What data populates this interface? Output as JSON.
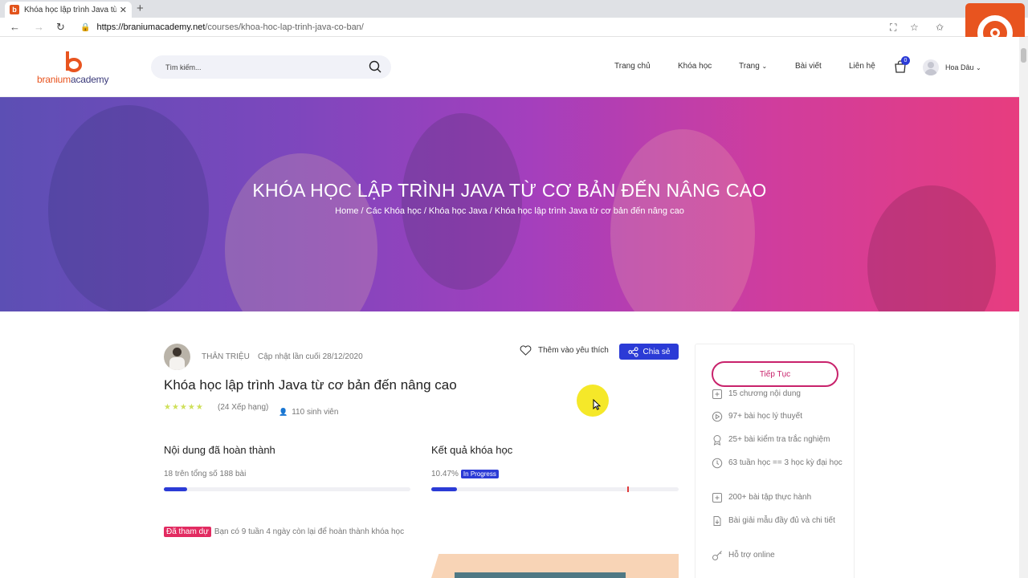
{
  "browser": {
    "tab_title": "Khóa học lập trình Java từ cơ bả",
    "tab_favicon": "b",
    "new_tab": "+",
    "url_host": "https://braniumacademy.net",
    "url_path": "/courses/khoa-hoc-lap-trinh-java-co-ban/"
  },
  "site": {
    "logo_part1": "branium",
    "logo_part2": "academy",
    "search_placeholder": "Tìm kiếm...",
    "nav": [
      "Trang chủ",
      "Khóa học",
      "Trang",
      "Bài viết",
      "Liên hệ"
    ],
    "cart_count": "0",
    "username": "Hoa Dâu"
  },
  "hero": {
    "title": "KHÓA HỌC LẬP TRÌNH JAVA TỪ CƠ BẢN ĐẾN NÂNG CAO",
    "breadcrumb": "Home / Các Khóa học / Khóa học Java / Khóa học lập trình Java từ cơ bản đến nâng cao"
  },
  "course": {
    "author": "THÂN TRIỆU",
    "updated": "Cập nhật lần cuối 28/12/2020",
    "wishlist_label": "Thêm vào yêu thích",
    "share_label": "Chia sẻ",
    "title": "Khóa học lập trình Java từ cơ bản đến nâng cao",
    "stars": "★★★★★",
    "ratings": "(24 Xếp hạng)",
    "students": "110 sinh viên"
  },
  "progress": {
    "content_heading": "Nội dung đã hoàn thành",
    "content_sub": "18 trên tổng số 188 bài",
    "content_fraction": 0.0957,
    "result_heading": "Kết quả khóa học",
    "result_value": "10.47%",
    "result_status": "In Progress",
    "result_fraction": 0.1047,
    "joined_label": "Đã tham dự",
    "joined_text": "Bạn có 9 tuần 4 ngày còn lại để hoàn thành khóa học"
  },
  "sidebar": {
    "continue_label": "Tiếp Tục",
    "features": [
      {
        "icon": "plus-square-icon",
        "text": "15 chương nội dung"
      },
      {
        "icon": "play-circle-icon",
        "text": "97+ bài học lý thuyết"
      },
      {
        "icon": "award-icon",
        "text": "25+ bài kiểm tra trắc nghiệm"
      },
      {
        "icon": "clock-icon",
        "text": "63 tuần học == 3 học kỳ đại học"
      },
      {
        "icon": "plus-square-icon",
        "text": "200+ bài tập thực hành"
      },
      {
        "icon": "download-file-icon",
        "text": "Bài giải mẫu đầy đủ và chi tiết"
      },
      {
        "icon": "key-icon",
        "text": "Hỗ trợ online"
      }
    ]
  },
  "colors": {
    "brand_orange": "#e8541f",
    "primary_blue": "#2b3bd6",
    "accent_pink": "#c8226b",
    "hero_gradient": [
      "#5c4fb4",
      "#a43fbd",
      "#e73d7f"
    ]
  }
}
